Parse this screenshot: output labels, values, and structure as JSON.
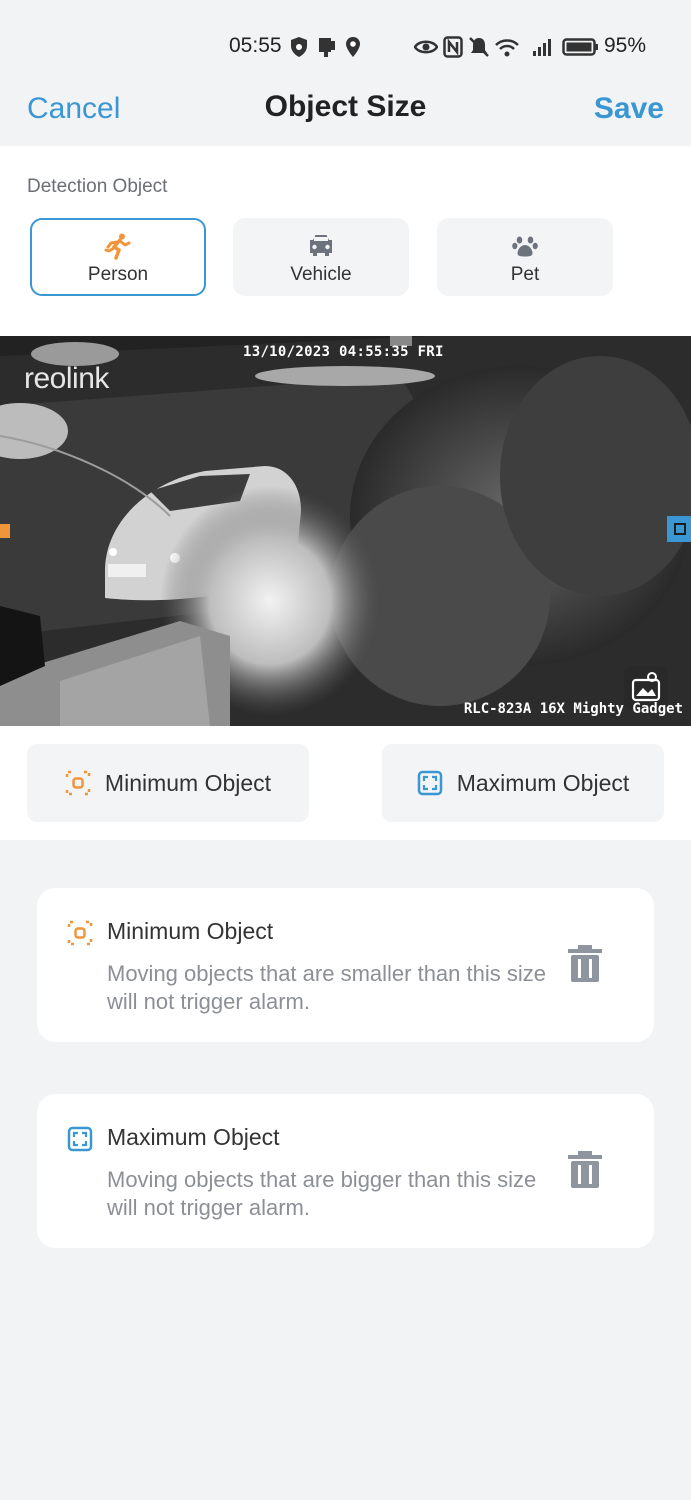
{
  "status_bar": {
    "time": "05:55",
    "battery": "95%",
    "icons": [
      "shield-icon",
      "phone-icon",
      "location-icon",
      "eye-icon",
      "nfc-icon",
      "mute-icon",
      "wifi-icon",
      "signal-icon",
      "battery-icon"
    ]
  },
  "nav": {
    "cancel": "Cancel",
    "title": "Object Size",
    "save": "Save",
    "accent_color": "#3a97d4"
  },
  "detection": {
    "label": "Detection Object",
    "objects": [
      {
        "label": "Person",
        "icon": "running-person-icon",
        "selected": true
      },
      {
        "label": "Vehicle",
        "icon": "car-icon",
        "selected": false
      },
      {
        "label": "Pet",
        "icon": "paw-icon",
        "selected": false
      }
    ]
  },
  "camera": {
    "timestamp": "13/10/2023 04:55:35 FRI",
    "logo": "reolink",
    "model": "RLC-823A 16X Mighty Gadget",
    "min_marker_color": "#f0953a",
    "max_marker_color": "#3a97d4"
  },
  "size_buttons": {
    "minimum": "Minimum Object",
    "maximum": "Maximum Object"
  },
  "cards": [
    {
      "title": "Minimum Object",
      "desc": "Moving objects that are smaller than this size will not trigger alarm.",
      "icon": "minimum-object-icon"
    },
    {
      "title": "Maximum Object",
      "desc": "Moving objects that are bigger than this size will not trigger alarm.",
      "icon": "maximum-object-icon"
    }
  ]
}
